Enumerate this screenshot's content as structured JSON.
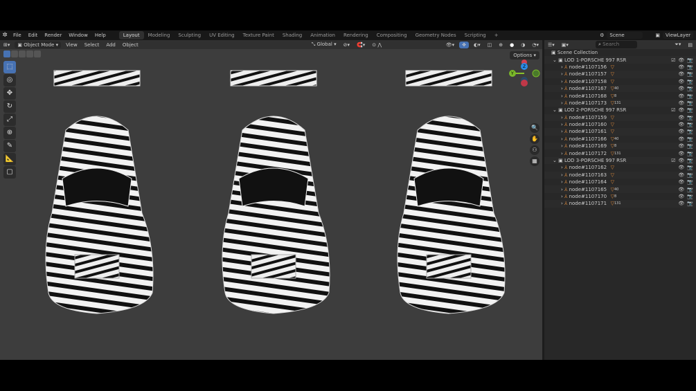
{
  "topbar": {
    "menus": [
      "File",
      "Edit",
      "Render",
      "Window",
      "Help"
    ],
    "workspaces": [
      "Layout",
      "Modeling",
      "Sculpting",
      "UV Editing",
      "Texture Paint",
      "Shading",
      "Animation",
      "Rendering",
      "Compositing",
      "Geometry Nodes",
      "Scripting"
    ],
    "active_workspace": "Layout",
    "add_tab": "+",
    "scene": "Scene",
    "view_layer": "ViewLayer"
  },
  "viewport": {
    "mode": "Object Mode",
    "menus": [
      "View",
      "Select",
      "Add",
      "Object"
    ],
    "transform_orientation": "Global",
    "options": "Options",
    "gizmo_labels": {
      "z": "Z",
      "y": "Y",
      "x": "X"
    },
    "tools": [
      "select-box",
      "cursor",
      "move",
      "rotate",
      "scale",
      "transform",
      "annotate",
      "measure",
      "add-cube"
    ]
  },
  "outliner": {
    "search_placeholder": "Search",
    "root": "Scene Collection",
    "collections": [
      {
        "name": "LOD 1-PORSCHE 997 RSR",
        "items": [
          {
            "name": "node#1107156",
            "badge": ""
          },
          {
            "name": "node#1107157",
            "badge": ""
          },
          {
            "name": "node#1107158",
            "badge": ""
          },
          {
            "name": "node#1107167",
            "badge": "40"
          },
          {
            "name": "node#1107168",
            "badge": "8"
          },
          {
            "name": "node#1107173",
            "badge": "131"
          }
        ]
      },
      {
        "name": "LOD 2-PORSCHE 997 RSR",
        "items": [
          {
            "name": "node#1107159",
            "badge": ""
          },
          {
            "name": "node#1107160",
            "badge": ""
          },
          {
            "name": "node#1107161",
            "badge": ""
          },
          {
            "name": "node#1107166",
            "badge": "40"
          },
          {
            "name": "node#1107169",
            "badge": "8"
          },
          {
            "name": "node#1107172",
            "badge": "131"
          }
        ]
      },
      {
        "name": "LOD 3-PORSCHE 997 RSR",
        "items": [
          {
            "name": "node#1107162",
            "badge": ""
          },
          {
            "name": "node#1107163",
            "badge": ""
          },
          {
            "name": "node#1107164",
            "badge": ""
          },
          {
            "name": "node#1107165",
            "badge": "40"
          },
          {
            "name": "node#1107170",
            "badge": "8"
          },
          {
            "name": "node#1107171",
            "badge": "131"
          }
        ]
      }
    ]
  },
  "colors": {
    "accent": "#4772b3",
    "viewport_bg": "#3d3d3d",
    "outliner_bg": "#282828",
    "object_icon": "#e08a3a"
  }
}
